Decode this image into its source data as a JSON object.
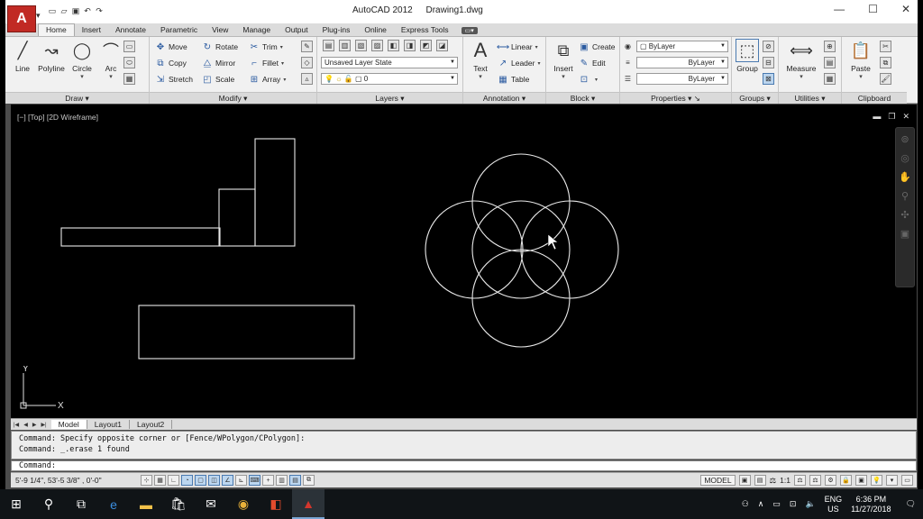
{
  "app": {
    "title": "AutoCAD 2012",
    "file": "Drawing1.dwg",
    "logo_letter": "A",
    "window_controls": [
      "—",
      "☐",
      "✕"
    ]
  },
  "ribbon_tabs": [
    "Home",
    "Insert",
    "Annotate",
    "Parametric",
    "View",
    "Manage",
    "Output",
    "Plug-ins",
    "Online",
    "Express Tools"
  ],
  "ribbon": {
    "draw": {
      "title": "Draw",
      "line": "Line",
      "polyline": "Polyline",
      "circle": "Circle",
      "arc": "Arc"
    },
    "modify": {
      "title": "Modify",
      "move": "Move",
      "rotate": "Rotate",
      "trim": "Trim",
      "copy": "Copy",
      "mirror": "Mirror",
      "fillet": "Fillet",
      "stretch": "Stretch",
      "scale": "Scale",
      "array": "Array"
    },
    "layers": {
      "title": "Layers",
      "layer_state": "Unsaved Layer State",
      "current_layer": "0"
    },
    "annotation": {
      "title": "Annotation",
      "text": "Text",
      "linear": "Linear",
      "leader": "Leader",
      "table": "Table"
    },
    "block": {
      "title": "Block",
      "insert": "Insert",
      "create": "Create",
      "edit": "Edit"
    },
    "properties": {
      "title": "Properties",
      "color": "ByLayer",
      "linetype": "ByLayer",
      "lineweight": "ByLayer"
    },
    "groups": {
      "title": "Groups",
      "group": "Group"
    },
    "utilities": {
      "title": "Utilities",
      "measure": "Measure"
    },
    "clipboard": {
      "title": "Clipboard",
      "paste": "Paste"
    }
  },
  "viewport": {
    "label": "[−] [Top] [2D Wireframe]",
    "ucs_y": "Y",
    "ucs_x": "X"
  },
  "layout_tabs": [
    "Model",
    "Layout1",
    "Layout2"
  ],
  "command": {
    "history": [
      "Command: Specify opposite corner or [Fence/WPolygon/CPolygon]:",
      "Command: _.erase 1 found"
    ],
    "prompt": "Command:"
  },
  "status": {
    "coords": "5'-9 1/4\",  53'-5 3/8\" , 0'-0\"",
    "model": "MODEL",
    "scale": "1:1"
  },
  "taskbar": {
    "lang": "ENG",
    "region": "US",
    "time": "6:36 PM",
    "date": "11/27/2018"
  }
}
